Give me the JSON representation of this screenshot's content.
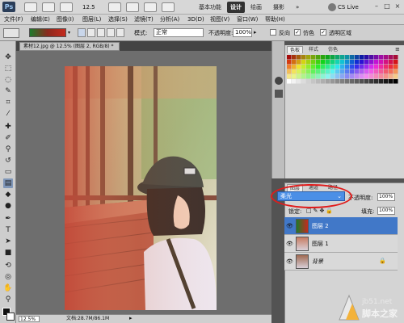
{
  "titlebar": {
    "app_logo": "Ps",
    "zoom_value": "12.5",
    "workspaces": [
      "基本功能",
      "设计",
      "绘画",
      "摄影"
    ],
    "active_workspace": "设计",
    "cs_live": "CS Live",
    "window_controls": [
      "–",
      "□",
      "×"
    ]
  },
  "menu": [
    "文件(F)",
    "编辑(E)",
    "图像(I)",
    "图层(L)",
    "选择(S)",
    "滤镜(T)",
    "分析(A)",
    "3D(D)",
    "视图(V)",
    "窗口(W)",
    "帮助(H)"
  ],
  "options": {
    "mode_label": "模式:",
    "mode_value": "正常",
    "opacity_label": "不透明度:",
    "opacity_value": "100%",
    "reverse_label": "反向",
    "dither_label": "仿色",
    "transparency_label": "透明区域"
  },
  "document": {
    "tab_title": "素材12.jpg @ 12.5% (图层 2, RGB/8) *",
    "zoom": "12.5%",
    "doc_size": "文档:28.7M/86.1M"
  },
  "swatches": {
    "tabs": [
      "色板",
      "样式",
      "仿色"
    ],
    "active_tab": "色板"
  },
  "layers": {
    "tabs": [
      "图层",
      "通道",
      "路径"
    ],
    "active_tab": "图层",
    "blend_mode": "柔光",
    "opacity_label": "不透明度:",
    "opacity_value": "100%",
    "lock_label": "锁定:",
    "fill_label": "填充:",
    "fill_value": "100%",
    "items": [
      {
        "name": "图层 2",
        "active": true
      },
      {
        "name": "图层 1",
        "active": false
      },
      {
        "name": "背景",
        "active": false
      }
    ]
  },
  "watermark": {
    "site": "jb51.net",
    "name": "脚本之家"
  },
  "colors": {
    "accent_blue": "#4178c8",
    "highlight_red": "#e01c1c",
    "workspace_dark": "#333333"
  },
  "icons": [
    "ps-logo-icon",
    "bridge-icon",
    "minibridge-icon",
    "zoom-icon",
    "hand-icon",
    "rotate-icon",
    "move-icon",
    "marquee-icon",
    "lasso-icon",
    "quick-select-icon",
    "crop-icon",
    "eyedropper-icon",
    "healing-icon",
    "brush-icon",
    "clone-icon",
    "history-brush-icon",
    "eraser-icon",
    "gradient-icon",
    "blur-icon",
    "dodge-icon",
    "pen-icon",
    "type-icon",
    "path-select-icon",
    "shape-icon",
    "3d-rotate-icon",
    "3d-orbit-icon",
    "hand-tool-icon",
    "zoom-tool-icon",
    "eye-icon",
    "lock-icon"
  ]
}
